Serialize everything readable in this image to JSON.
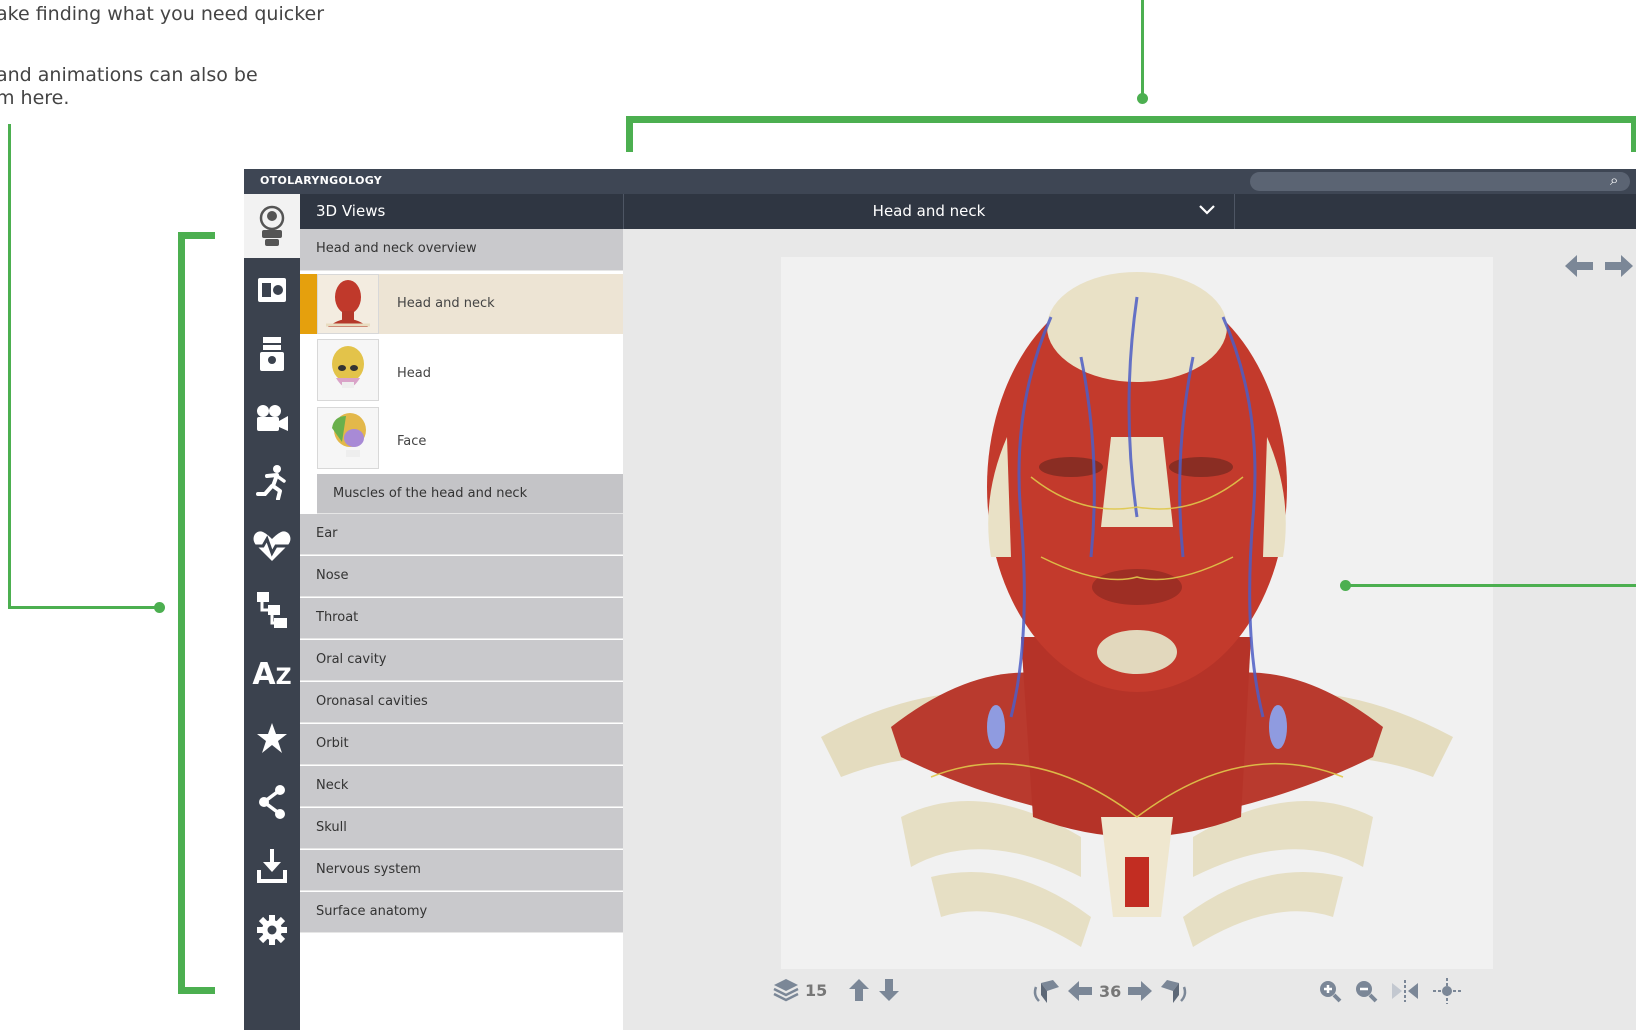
{
  "annotations": {
    "line1": "ake finding what you need quicker",
    "line2": "and animations can also be",
    "line3": "m here."
  },
  "app": {
    "title": "OTOLARYNGOLOGY",
    "search": {
      "placeholder": ""
    }
  },
  "sidebar_icons": [
    "3d-views-icon",
    "slides-icon",
    "dissection-icon",
    "movies-icon",
    "animations-icon",
    "conditions-icon",
    "hierarchy-icon",
    "a-to-z-icon",
    "favorites-icon",
    "share-icon",
    "download-icon",
    "settings-icon"
  ],
  "list": {
    "header": "3D Views",
    "items": [
      {
        "label": "Head and neck overview",
        "type": "group"
      },
      {
        "label": "Head and neck",
        "type": "thumb",
        "selected": true
      },
      {
        "label": "Head",
        "type": "thumb"
      },
      {
        "label": "Face",
        "type": "thumb"
      },
      {
        "label": "Muscles of the head and neck",
        "type": "sub"
      },
      {
        "label": "Ear",
        "type": "group"
      },
      {
        "label": "Nose",
        "type": "group"
      },
      {
        "label": "Throat",
        "type": "group"
      },
      {
        "label": "Oral cavity",
        "type": "group"
      },
      {
        "label": "Oronasal cavities",
        "type": "group"
      },
      {
        "label": "Orbit",
        "type": "group"
      },
      {
        "label": "Neck",
        "type": "group"
      },
      {
        "label": "Skull",
        "type": "group"
      },
      {
        "label": "Nervous system",
        "type": "group"
      },
      {
        "label": "Surface anatomy",
        "type": "group"
      }
    ]
  },
  "viewer": {
    "dropdown_label": "Head and neck",
    "layers_count": "15",
    "rotation_steps": "36"
  },
  "colors": {
    "accent": "#4caf50",
    "selected_marker": "#e5a00d",
    "rail": "#3b424e"
  }
}
